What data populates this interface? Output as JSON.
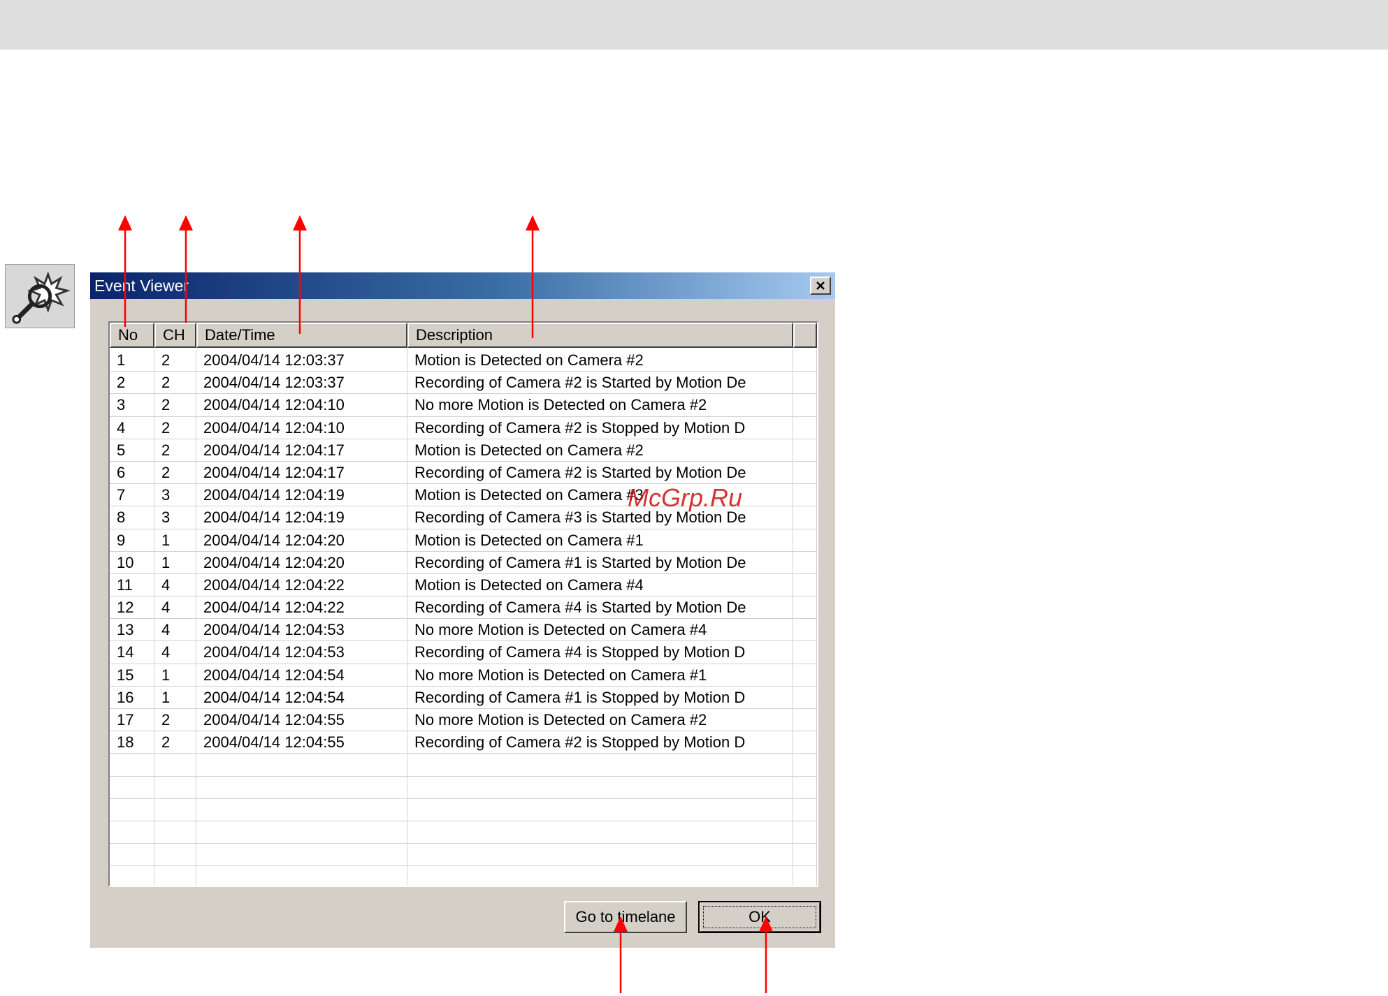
{
  "window": {
    "title": "Event Viewer",
    "close_icon": "close-icon"
  },
  "table": {
    "columns": [
      "No",
      "CH",
      "Date/Time",
      "Description"
    ],
    "rows": [
      [
        "1",
        "2",
        "2004/04/14 12:03:37",
        "Motion is Detected on Camera #2"
      ],
      [
        "2",
        "2",
        "2004/04/14 12:03:37",
        "Recording of Camera #2 is Started by Motion De"
      ],
      [
        "3",
        "2",
        "2004/04/14 12:04:10",
        "No more Motion is Detected on Camera #2"
      ],
      [
        "4",
        "2",
        "2004/04/14 12:04:10",
        "Recording of Camera #2 is Stopped by Motion D"
      ],
      [
        "5",
        "2",
        "2004/04/14 12:04:17",
        "Motion is Detected on Camera #2"
      ],
      [
        "6",
        "2",
        "2004/04/14 12:04:17",
        "Recording of Camera #2 is Started by Motion De"
      ],
      [
        "7",
        "3",
        "2004/04/14 12:04:19",
        "Motion is Detected on Camera #3"
      ],
      [
        "8",
        "3",
        "2004/04/14 12:04:19",
        "Recording of Camera #3 is Started by Motion De"
      ],
      [
        "9",
        "1",
        "2004/04/14 12:04:20",
        "Motion is Detected on Camera #1"
      ],
      [
        "10",
        "1",
        "2004/04/14 12:04:20",
        "Recording of Camera #1 is Started by Motion De"
      ],
      [
        "11",
        "4",
        "2004/04/14 12:04:22",
        "Motion is Detected on Camera #4"
      ],
      [
        "12",
        "4",
        "2004/04/14 12:04:22",
        "Recording of Camera #4 is Started by Motion De"
      ],
      [
        "13",
        "4",
        "2004/04/14 12:04:53",
        "No more Motion is Detected on Camera #4"
      ],
      [
        "14",
        "4",
        "2004/04/14 12:04:53",
        "Recording of Camera #4 is Stopped by Motion D"
      ],
      [
        "15",
        "1",
        "2004/04/14 12:04:54",
        "No more Motion is Detected on Camera #1"
      ],
      [
        "16",
        "1",
        "2004/04/14 12:04:54",
        "Recording of Camera #1 is Stopped by Motion D"
      ],
      [
        "17",
        "2",
        "2004/04/14 12:04:55",
        "No more Motion is Detected on Camera #2"
      ],
      [
        "18",
        "2",
        "2004/04/14 12:04:55",
        "Recording of Camera #2 is Stopped by Motion D"
      ],
      [
        "",
        "",
        "",
        ""
      ],
      [
        "",
        "",
        "",
        ""
      ],
      [
        "",
        "",
        "",
        ""
      ],
      [
        "",
        "",
        "",
        ""
      ],
      [
        "",
        "",
        "",
        ""
      ],
      [
        "",
        "",
        "",
        ""
      ]
    ]
  },
  "buttons": {
    "timelane": "Go to timelane",
    "ok": "OK"
  },
  "watermark": "McGrp.Ru",
  "icons": {
    "event_icon": "event-viewer-icon"
  },
  "colors": {
    "title_gradient_start": "#0a246a",
    "title_gradient_end": "#a6caf0",
    "dialog_face": "#d4d0c8",
    "annotation_arrow": "#ff0000"
  }
}
